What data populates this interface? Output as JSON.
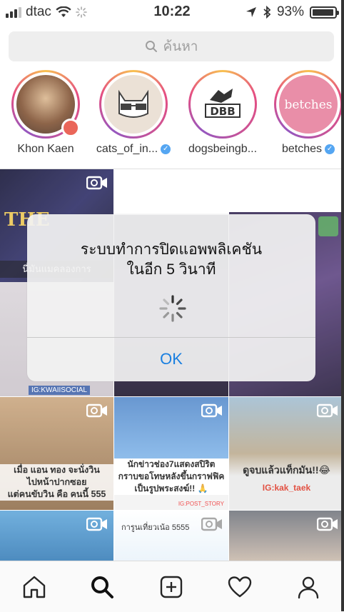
{
  "status_bar": {
    "carrier": "dtac",
    "time": "10:22",
    "battery": "93%"
  },
  "search": {
    "placeholder": "ค้นหา"
  },
  "stories": [
    {
      "name": "Khon Kaen",
      "verified": false,
      "location": true
    },
    {
      "name": "cats_of_in...",
      "verified": true
    },
    {
      "name": "dogsbeingb...",
      "verified": false
    },
    {
      "name": "betches",
      "verified": true
    }
  ],
  "grid": {
    "tile_1_text": "THE",
    "tile_1_caption": "นี่มันแมคลองการ",
    "tile_2_ig": "IG:KWAIISOCIAL",
    "tile_4_caption": "เมื่อ แอน ทอง จะนั่งวิน\nไปหน้าปากซอย\nแต่คนขับวิน คือ คนนี้ 555",
    "tile_5_caption": "นักข่าวช่อง7แสดงสปิริต\nกราบขอโทษหลังขึ้นกราฟฟิค\nเป็นรูปพระสงฆ์!! 🙏",
    "tile_5_source": "IG:POST_STORY",
    "tile_6_caption": "ดูจบแล้วแท็กมัน!!😂",
    "tile_6_ig": "IG:kak_taek",
    "tile_8_caption": "การูนเที่ยวเน้อ 5555"
  },
  "dialog": {
    "message_line1": "ระบบทำการปิดแอพพลิเคชัน",
    "message_line2": "ในอีก 5 วินาที",
    "ok_label": "OK"
  },
  "tabbar": {
    "tabs": [
      "home-icon",
      "search-icon",
      "add-icon",
      "heart-icon",
      "profile-icon"
    ]
  }
}
